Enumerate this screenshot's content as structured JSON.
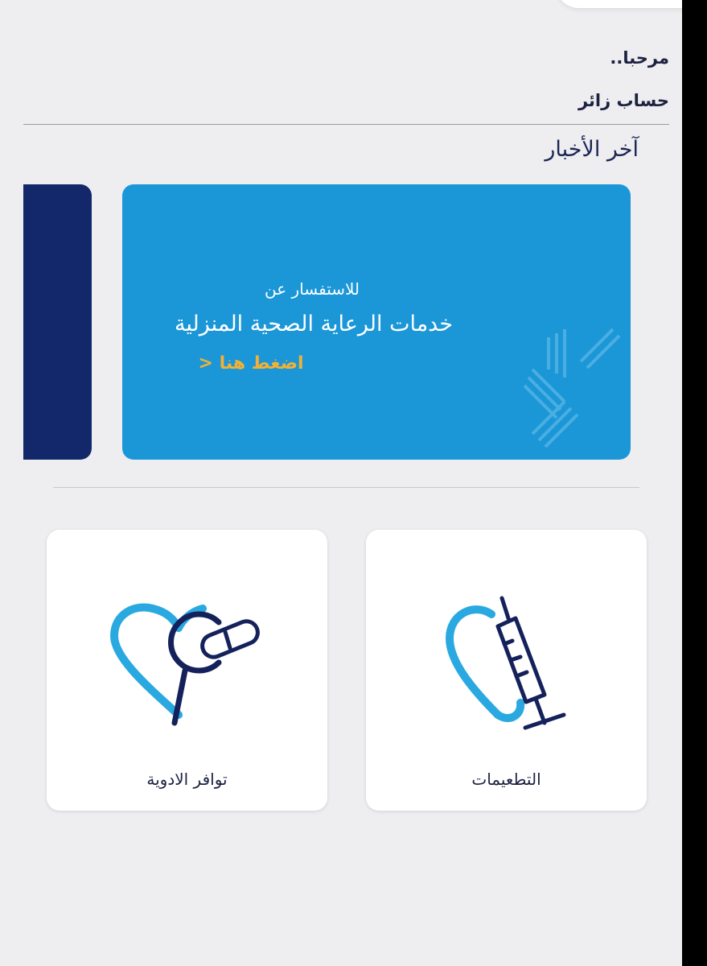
{
  "header": {
    "greeting": "مرحبا..",
    "account_name": "حساب زائر"
  },
  "news": {
    "title": "آخر الأخبار",
    "banner": {
      "line1": "للاستفسار عن",
      "line2": "خدمات الرعاية الصحية المنزلية",
      "cta": "اضغط هنا <"
    }
  },
  "services": [
    {
      "label": "التطعيمات",
      "icon": "vaccine-syringe-heart-icon"
    },
    {
      "label": "توافر الادوية",
      "icon": "medicine-search-heart-icon"
    }
  ],
  "colors": {
    "background": "#eeedf0",
    "banner": "#1b97d8",
    "navy": "#13286b",
    "cta": "#f2b135",
    "icon_light": "#2aa9e0",
    "icon_dark": "#15215a"
  }
}
